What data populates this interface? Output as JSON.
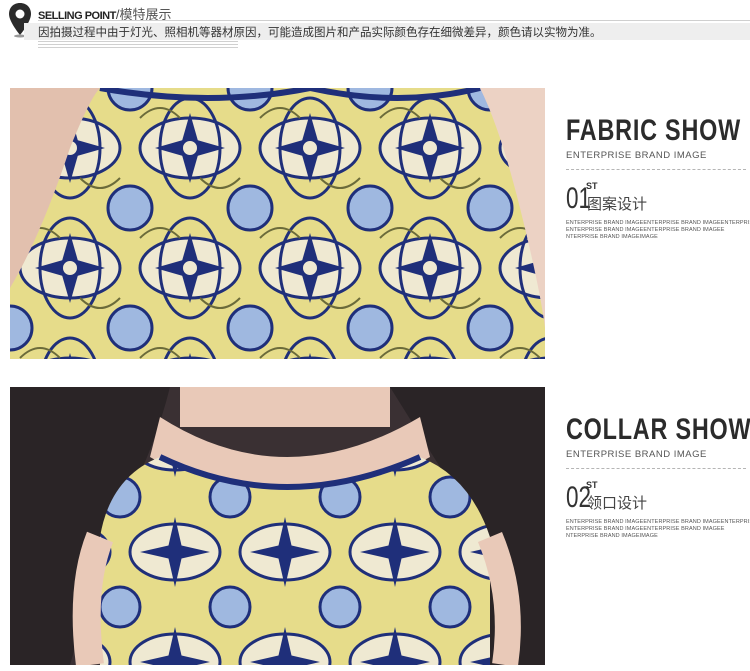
{
  "header": {
    "title_en": "SELLING POINT",
    "separator": "/",
    "title_cn": "模特展示",
    "notice": "因拍摄过程中由于灯光、照相机等器材原因，可能造成图片和产品实际颜色存在细微差异，颜色请以实物为准。",
    "icon": "map-pin-icon"
  },
  "sections": [
    {
      "title": "FABRIC SHOW",
      "subtitle": "ENTERPRISE BRAND IMAGE",
      "number": "01",
      "number_suffix": "ST",
      "label": "图案设计",
      "fine_print": [
        "ENTERPRISE BRAND IMAGEENTERPRISE BRAND IMAGEENTERPRISE BRAND",
        "ENTERPRISE BRAND IMAGEENTERPRISE BRAND IMAGEE",
        "NTERPRISE BRAND IMAGEIMAGE"
      ]
    },
    {
      "title": "COLLAR SHOW",
      "subtitle": "ENTERPRISE BRAND IMAGE",
      "number": "02",
      "number_suffix": "ST",
      "label": "领口设计",
      "fine_print": [
        "ENTERPRISE BRAND IMAGEENTERPRISE BRAND IMAGEENTERPRISE BRAND",
        "ENTERPRISE BRAND IMAGEENTERPRISE BRAND IMAGEE",
        "NTERPRISE BRAND IMAGEIMAGE"
      ]
    }
  ],
  "colors": {
    "navy": "#1f2f7a",
    "yellow": "#e6dc8a",
    "light_blue": "#9fb8e0",
    "cream": "#efe9d2",
    "skin": "#e9c9b8",
    "hair": "#2a2426"
  }
}
